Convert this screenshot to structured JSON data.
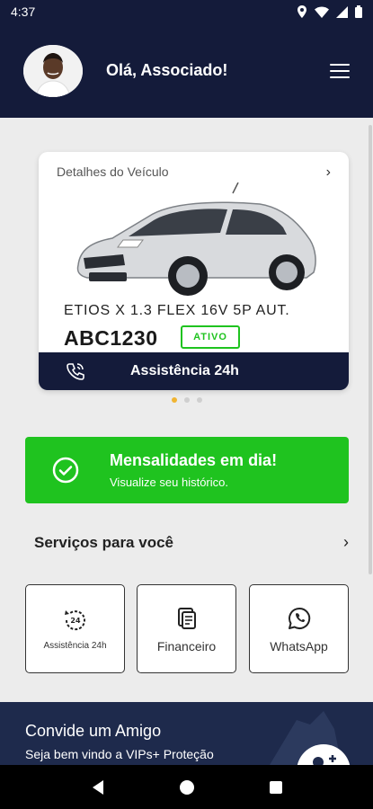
{
  "status_bar": {
    "time": "4:37"
  },
  "header": {
    "greeting": "Olá, Associado!"
  },
  "vehicle_card": {
    "title": "Detalhes do Veículo",
    "model": "ETIOS X 1.3 FLEX 16V 5P AUT.",
    "plate": "ABC1230",
    "status": "ATIVO",
    "assistance_label": "Assistência 24h"
  },
  "carousel": {
    "count": 3,
    "active": 1
  },
  "fees_card": {
    "title": "Mensalidades em dia!",
    "subtitle": "Visualize seu histórico."
  },
  "services": {
    "title": "Serviços para você",
    "items": [
      {
        "label": "Assistência 24h",
        "icon": "assistance-24h-icon"
      },
      {
        "label": "Financeiro",
        "icon": "document-icon"
      },
      {
        "label": "WhatsApp",
        "icon": "whatsapp-icon"
      }
    ]
  },
  "invite": {
    "title": "Convide um Amigo",
    "subtitle": "Seja bem vindo a VIPs+ Proteção"
  },
  "colors": {
    "navy": "#141b3a",
    "success_green": "#1fc31f",
    "active_dot": "#f0b432"
  }
}
